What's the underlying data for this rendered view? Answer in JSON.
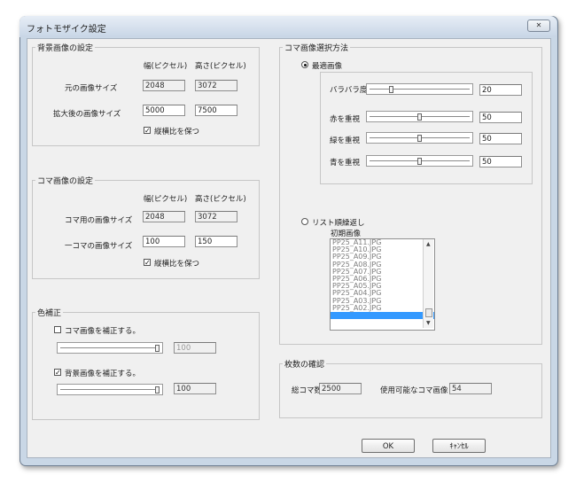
{
  "window": {
    "title": "フォトモザイク設定",
    "close_glyph": "✕"
  },
  "background_group": {
    "legend": "背景画像の設定",
    "col_width": "幅(ピクセル)",
    "col_height": "高さ(ピクセル)",
    "original_label": "元の画像サイズ",
    "original_width": "2048",
    "original_height": "3072",
    "enlarged_label": "拡大後の画像サイズ",
    "enlarged_width": "5000",
    "enlarged_height": "7500",
    "keep_ratio_label": "縦横比を保つ",
    "keep_ratio_checked": true
  },
  "tile_group": {
    "legend": "コマ画像の設定",
    "col_width": "幅(ピクセル)",
    "col_height": "高さ(ピクセル)",
    "tile_size_label": "コマ用の画像サイズ",
    "tile_width": "2048",
    "tile_height": "3072",
    "per_tile_label": "一コマの画像サイズ",
    "per_tile_width": "100",
    "per_tile_height": "150",
    "keep_ratio_label": "縦横比を保つ",
    "keep_ratio_checked": true
  },
  "color_group": {
    "legend": "色補正",
    "tile_correct_label": "コマ画像を補正する。",
    "tile_correct_checked": false,
    "tile_correct_value": "100",
    "tile_slider_level": 1.0,
    "bg_correct_label": "背景画像を補正する。",
    "bg_correct_checked": true,
    "bg_correct_value": "100",
    "bg_slider_level": 1.0
  },
  "selection_group": {
    "legend": "コマ画像選択方法",
    "optimal_label": "最適画像",
    "optimal_selected": true,
    "variance_label": "バラバラ度",
    "variance_value": "20",
    "variance_level": 0.2,
    "red_label": "赤を重視",
    "red_value": "50",
    "red_level": 0.5,
    "green_label": "緑を重視",
    "green_value": "50",
    "green_level": 0.5,
    "blue_label": "青を重視",
    "blue_value": "50",
    "blue_level": 0.5,
    "list_label": "リスト順繰返し",
    "list_selected": false,
    "initial_label": "初期画像",
    "list_items": [
      "PP25_A11.JPG",
      "PP25_A10.JPG",
      "PP25_A09.JPG",
      "PP25_A08.JPG",
      "PP25_A07.JPG",
      "PP25_A06.JPG",
      "PP25_A05.JPG",
      "PP25_A04.JPG",
      "PP25_A03.JPG",
      "PP25_A02.JPG"
    ]
  },
  "count_group": {
    "legend": "枚数の確認",
    "total_label": "総コマ数",
    "total_value": "2500",
    "usable_label": "使用可能なコマ画像",
    "usable_value": "54"
  },
  "buttons": {
    "ok": "OK",
    "cancel": "ｷｬﾝｾﾙ"
  }
}
